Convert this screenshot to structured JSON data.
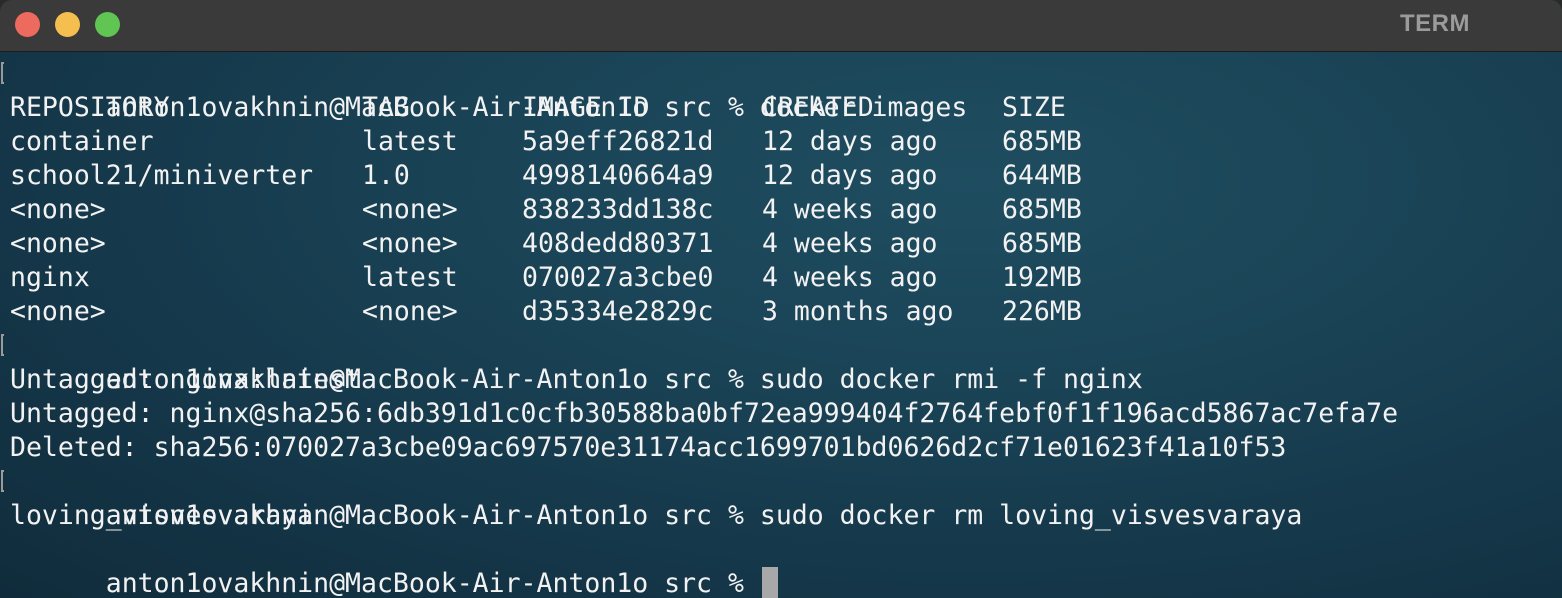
{
  "window": {
    "title": "TERM",
    "controls": [
      "close",
      "minimize",
      "zoom"
    ]
  },
  "colors": {
    "background": "#1a4356",
    "titlebar": "#3a3a3a",
    "text": "#f2f2f2",
    "cursor": "#a8a8a8"
  },
  "session": {
    "cmd1": "anton1ovakhnin@MacBook-Air-Anton1o src % docker images",
    "table": {
      "headers": [
        "REPOSITORY",
        "TAG",
        "IMAGE ID",
        "CREATED",
        "SIZE"
      ],
      "rows": [
        [
          "container",
          "latest",
          "5a9eff26821d",
          "12 days ago",
          "685MB"
        ],
        [
          "school21/miniverter",
          "1.0",
          "4998140664a9",
          "12 days ago",
          "644MB"
        ],
        [
          "<none>",
          "<none>",
          "838233dd138c",
          "4 weeks ago",
          "685MB"
        ],
        [
          "<none>",
          "<none>",
          "408dedd80371",
          "4 weeks ago",
          "685MB"
        ],
        [
          "nginx",
          "latest",
          "070027a3cbe0",
          "4 weeks ago",
          "192MB"
        ],
        [
          "<none>",
          "<none>",
          "d35334e2829c",
          "3 months ago",
          "226MB"
        ]
      ]
    },
    "cmd2": "anton1ovakhnin@MacBook-Air-Anton1o src % sudo docker rmi -f nginx",
    "out2": [
      "Untagged: nginx:latest",
      "Untagged: nginx@sha256:6db391d1c0cfb30588ba0bf72ea999404f2764febf0f1f196acd5867ac7efa7e",
      "Deleted: sha256:070027a3cbe09ac697570e31174acc1699701bd0626d2cf71e01623f41a10f53"
    ],
    "cmd3": "anton1ovakhnin@MacBook-Air-Anton1o src % sudo docker rm loving_visvesvaraya",
    "out3": "loving_visvesvaraya",
    "prompt": "anton1ovakhnin@MacBook-Air-Anton1o src % "
  }
}
